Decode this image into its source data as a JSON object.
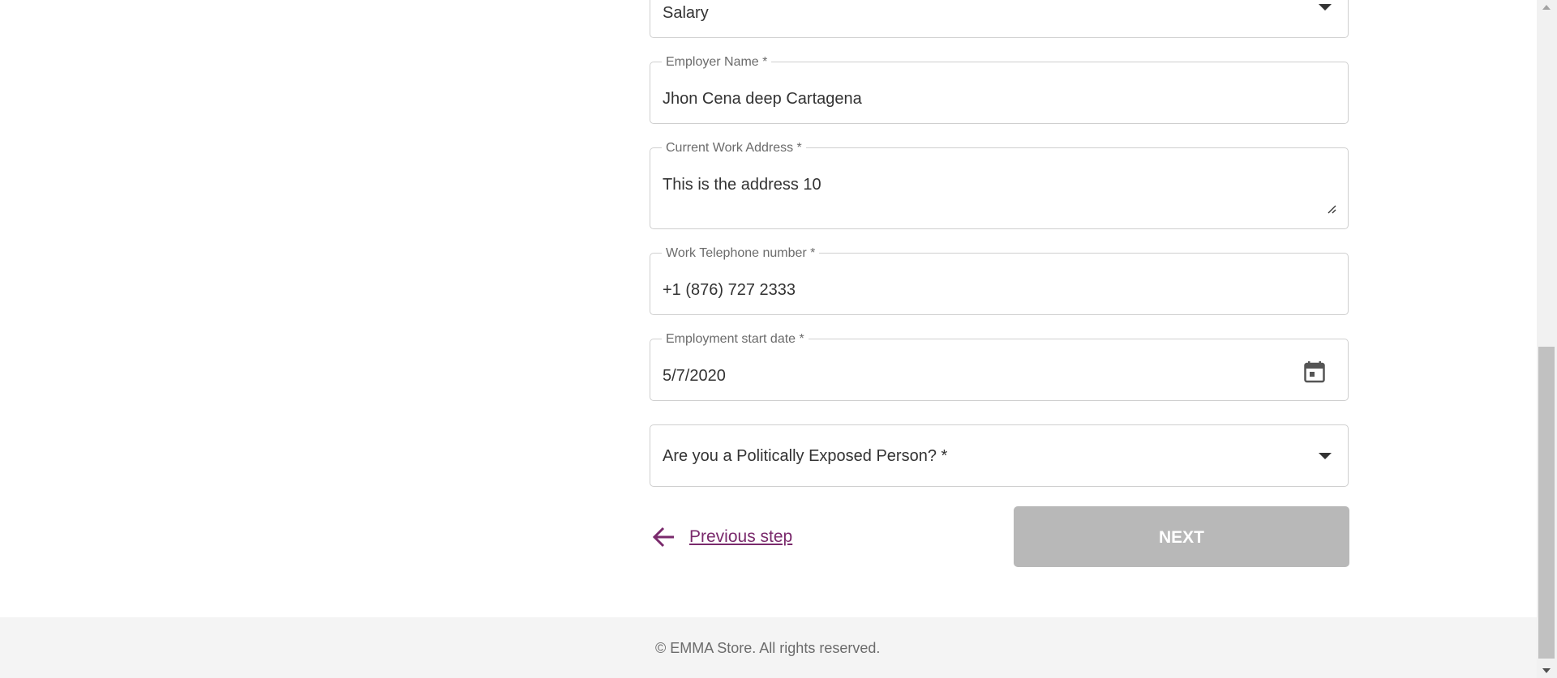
{
  "form": {
    "income_type": {
      "value": "Salary",
      "icon": "chevron-down-icon"
    },
    "employer_name": {
      "label": "Employer Name *",
      "value": "Jhon Cena deep Cartagena"
    },
    "work_address": {
      "label": "Current Work Address *",
      "value": "This is the address 10",
      "icon": "resize-handle-icon"
    },
    "work_phone": {
      "label": "Work Telephone number *",
      "value": "+1 (876) 727 2333"
    },
    "start_date": {
      "label": "Employment start date *",
      "value": "5/7/2020",
      "icon": "calendar-icon"
    },
    "pep": {
      "placeholder": "Are you a Politically Exposed Person? *",
      "icon": "chevron-down-icon"
    }
  },
  "navigation": {
    "previous_label": "Previous step",
    "previous_icon": "arrow-left-icon",
    "next_label": "NEXT",
    "next_enabled": false
  },
  "footer": {
    "copyright": "© EMMA Store. All rights reserved."
  },
  "colors": {
    "accent": "#7a2a6c",
    "disabled_button": "#b8b8b8",
    "border": "#cfcfcf",
    "footer_bg": "#f4f4f4"
  }
}
